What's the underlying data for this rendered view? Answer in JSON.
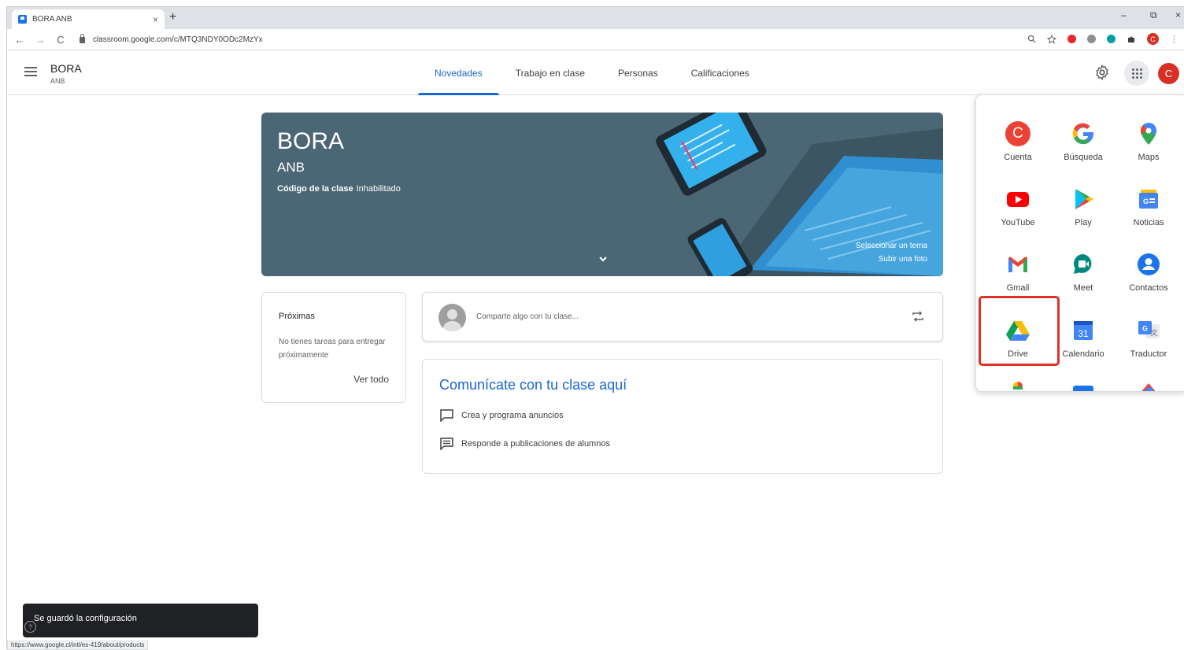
{
  "browser": {
    "tab_title": "BORA ANB",
    "tab_close": "×",
    "new_tab": "+",
    "url": "classroom.google.com/c/MTQ3NDY0ODc2MzYx",
    "back": "←",
    "forward": "→",
    "reload": "C",
    "minimize": "–",
    "restore": "⧉",
    "close": "×",
    "profile_initial": "C"
  },
  "appbar": {
    "class_name": "BORA",
    "class_section": "ANB",
    "tabs": [
      "Novedades",
      "Trabajo en clase",
      "Personas",
      "Calificaciones"
    ],
    "active_tab": "Novedades",
    "avatar_initial": "C"
  },
  "banner": {
    "title": "BORA",
    "subtitle": "ANB",
    "code_label": "Código de la clase",
    "code_value": "Inhabilitado",
    "select_theme": "Seleccionar un tema",
    "upload_photo": "Subir una foto"
  },
  "upcoming": {
    "heading": "Próximas",
    "text": "No tienes tareas para entregar próximamente",
    "view_all": "Ver todo"
  },
  "share": {
    "placeholder": "Comparte algo con tu clase..."
  },
  "communicate": {
    "heading": "Comunícate con tu clase aquí",
    "item1": "Crea y programa anuncios",
    "item2": "Responde a publicaciones de alumnos"
  },
  "apps": {
    "items": [
      "Cuenta",
      "Búsqueda",
      "Maps",
      "YouTube",
      "Play",
      "Noticias",
      "Gmail",
      "Meet",
      "Contactos",
      "Drive",
      "Calendario",
      "Traductor"
    ],
    "account_initial": "C",
    "calendar_day": "31",
    "highlighted": "Drive",
    "colors": {
      "red": "#ea4335",
      "blue": "#4285f4",
      "green": "#34a853",
      "yellow": "#fbbc04"
    }
  },
  "snackbar": {
    "message": "Se guardó la configuración"
  },
  "status_url": "https://www.google.cl/intl/es-419/about/products",
  "help": "?"
}
